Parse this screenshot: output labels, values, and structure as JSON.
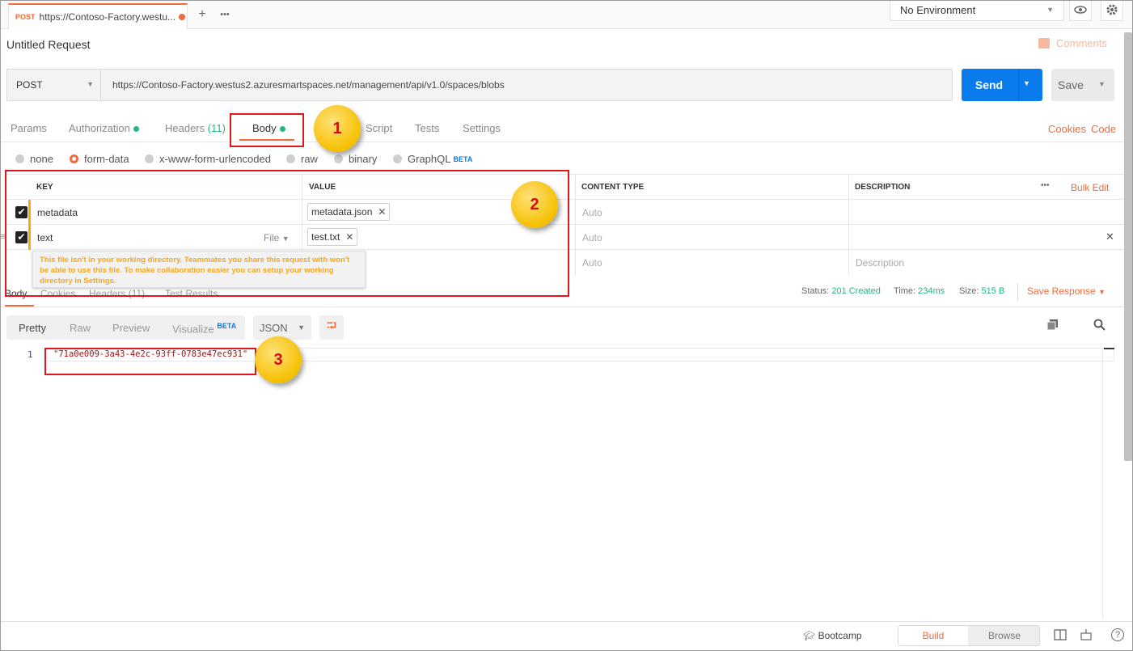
{
  "tab": {
    "method": "POST",
    "url_short": "https://Contoso-Factory.westu..."
  },
  "tabstrip": {
    "add": "+",
    "more": "•••"
  },
  "environment": {
    "selected": "No Environment"
  },
  "request": {
    "title": "Untitled Request",
    "comments_label": "Comments"
  },
  "url_bar": {
    "method": "POST",
    "url": "https://Contoso-Factory.westus2.azuresmartspaces.net/management/api/v1.0/spaces/blobs",
    "send_label": "Send",
    "save_label": "Save"
  },
  "request_tabs": {
    "params": "Params",
    "authorization": "Authorization",
    "headers": "Headers",
    "headers_count": "(11)",
    "body": "Body",
    "prerequest_partial": "Script",
    "tests": "Tests",
    "settings": "Settings",
    "cookies": "Cookies",
    "code": "Code"
  },
  "body_types": [
    {
      "label": "none",
      "selected": false
    },
    {
      "label": "form-data",
      "selected": true
    },
    {
      "label": "x-www-form-urlencoded",
      "selected": false
    },
    {
      "label": "raw",
      "selected": false
    },
    {
      "label": "binary",
      "selected": false
    },
    {
      "label": "GraphQL",
      "selected": false,
      "badge": "BETA"
    }
  ],
  "form_table": {
    "headers": [
      "KEY",
      "VALUE",
      "CONTENT TYPE",
      "DESCRIPTION"
    ],
    "bulk_edit": "Bulk Edit",
    "more": "•••",
    "rows": [
      {
        "key": "metadata",
        "value": "metadata.json",
        "content_type": "Auto",
        "checked": true
      },
      {
        "key": "text",
        "type_label": "File",
        "value": "test.txt",
        "content_type": "Auto",
        "checked": true
      },
      {
        "content_type": "Auto",
        "description_placeholder": "Description"
      }
    ],
    "tooltip": "This file isn't in your working directory. Teammates you share this request with won't be able to use this file. To make collaboration easier you can setup your working directory in Settings."
  },
  "response_tabs": {
    "body": "Body",
    "cookies": "Cookies",
    "headers": "Headers (11)",
    "test_results": "Test Results"
  },
  "response_status": {
    "status_label": "Status:",
    "status_value": "201 Created",
    "time_label": "Time:",
    "time_value": "234ms",
    "size_label": "Size:",
    "size_value": "515 B",
    "save_response": "Save Response"
  },
  "viewer": {
    "modes": [
      "Pretty",
      "Raw",
      "Preview",
      "Visualize"
    ],
    "visualize_badge": "BETA",
    "format": "JSON"
  },
  "editor": {
    "line_number": "1",
    "content": "\"71a0e009-3a43-4e2c-93ff-0783e47ec931\""
  },
  "annotations": [
    "1",
    "2",
    "3"
  ],
  "footer": {
    "bootcamp": "Bootcamp",
    "build": "Build",
    "browse": "Browse",
    "help": "?"
  },
  "colors": {
    "accent": "#f26b3a",
    "send_blue": "#097bed",
    "success_green": "#26b47f",
    "annotation_red": "#e3141b",
    "annotation_badge": "#f5c000"
  }
}
